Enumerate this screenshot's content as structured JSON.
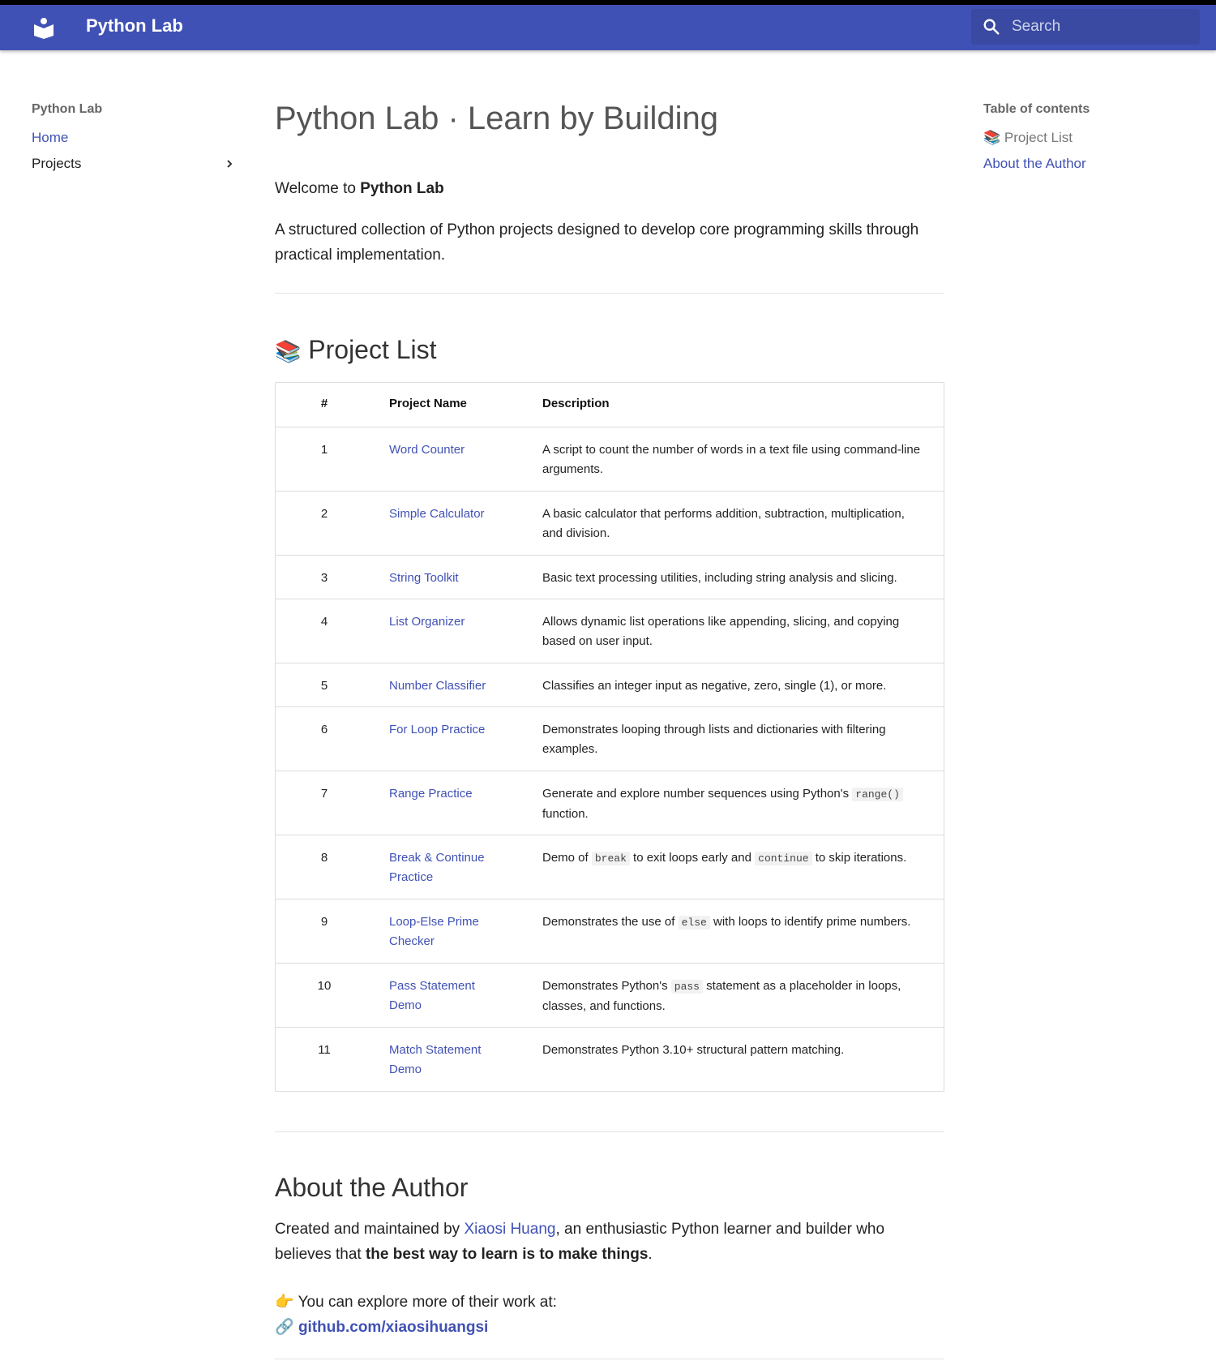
{
  "header": {
    "site_title": "Python Lab",
    "search_placeholder": "Search",
    "brand_color": "#4051b5",
    "logo_icon": "book-reader-icon"
  },
  "sidebar": {
    "title": "Python Lab",
    "items": [
      {
        "label": "Home"
      },
      {
        "label": "Projects"
      }
    ]
  },
  "toc": {
    "title": "Table of contents",
    "items": [
      {
        "emoji": "📚",
        "label": "Project List"
      },
      {
        "label": "About the Author"
      }
    ]
  },
  "main": {
    "title": "Python Lab · Learn by Building",
    "welcome_prefix": "Welcome to ",
    "welcome_bold": "Python Lab",
    "intro": "A structured collection of Python projects designed to develop core programming skills through practical implementation.",
    "project_heading_emoji": "📚",
    "project_heading": "Project List",
    "table": {
      "headers": [
        "#",
        "Project Name",
        "Description"
      ],
      "rows": [
        {
          "num": "1",
          "name": "Word Counter",
          "desc": [
            "A script to count the number of words in a text file using command-line arguments."
          ]
        },
        {
          "num": "2",
          "name": "Simple Calculator",
          "desc": [
            "A basic calculator that performs addition, subtraction, multiplication, and division."
          ]
        },
        {
          "num": "3",
          "name": "String Toolkit",
          "desc": [
            "Basic text processing utilities, including string analysis and slicing."
          ]
        },
        {
          "num": "4",
          "name": "List Organizer",
          "desc": [
            "Allows dynamic list operations like appending, slicing, and copying based on user input."
          ]
        },
        {
          "num": "5",
          "name": "Number Classifier",
          "desc": [
            "Classifies an integer input as negative, zero, single (1), or more."
          ]
        },
        {
          "num": "6",
          "name": "For Loop Practice",
          "desc": [
            "Demonstrates looping through lists and dictionaries with filtering examples."
          ]
        },
        {
          "num": "7",
          "name": "Range Practice",
          "desc": [
            "Generate and explore number sequences using Python's ",
            {
              "code": "range()"
            },
            " function."
          ]
        },
        {
          "num": "8",
          "name": "Break & Continue Practice",
          "desc": [
            "Demo of ",
            {
              "code": "break"
            },
            " to exit loops early and ",
            {
              "code": "continue"
            },
            " to skip iterations."
          ]
        },
        {
          "num": "9",
          "name": "Loop-Else Prime Checker",
          "desc": [
            "Demonstrates the use of ",
            {
              "code": "else"
            },
            " with loops to identify prime numbers."
          ]
        },
        {
          "num": "10",
          "name": "Pass Statement Demo",
          "desc": [
            "Demonstrates Python's ",
            {
              "code": "pass"
            },
            " statement as a placeholder in loops, classes, and functions."
          ]
        },
        {
          "num": "11",
          "name": "Match Statement Demo",
          "desc": [
            "Demonstrates Python 3.10+ structural pattern matching."
          ]
        }
      ]
    },
    "author_heading": "About the Author",
    "author_prefix": "Created and maintained by ",
    "author_name": "Xiaosi Huang",
    "author_middle": ", an enthusiastic Python learner and builder who believes that ",
    "author_bold": "the best way to learn is to make things",
    "author_suffix": ".",
    "explore_emoji": "👉",
    "explore_text": "You can explore more of their work at:",
    "link_emoji": "🔗",
    "github_link": "github.com/xiaosihuangsi"
  }
}
